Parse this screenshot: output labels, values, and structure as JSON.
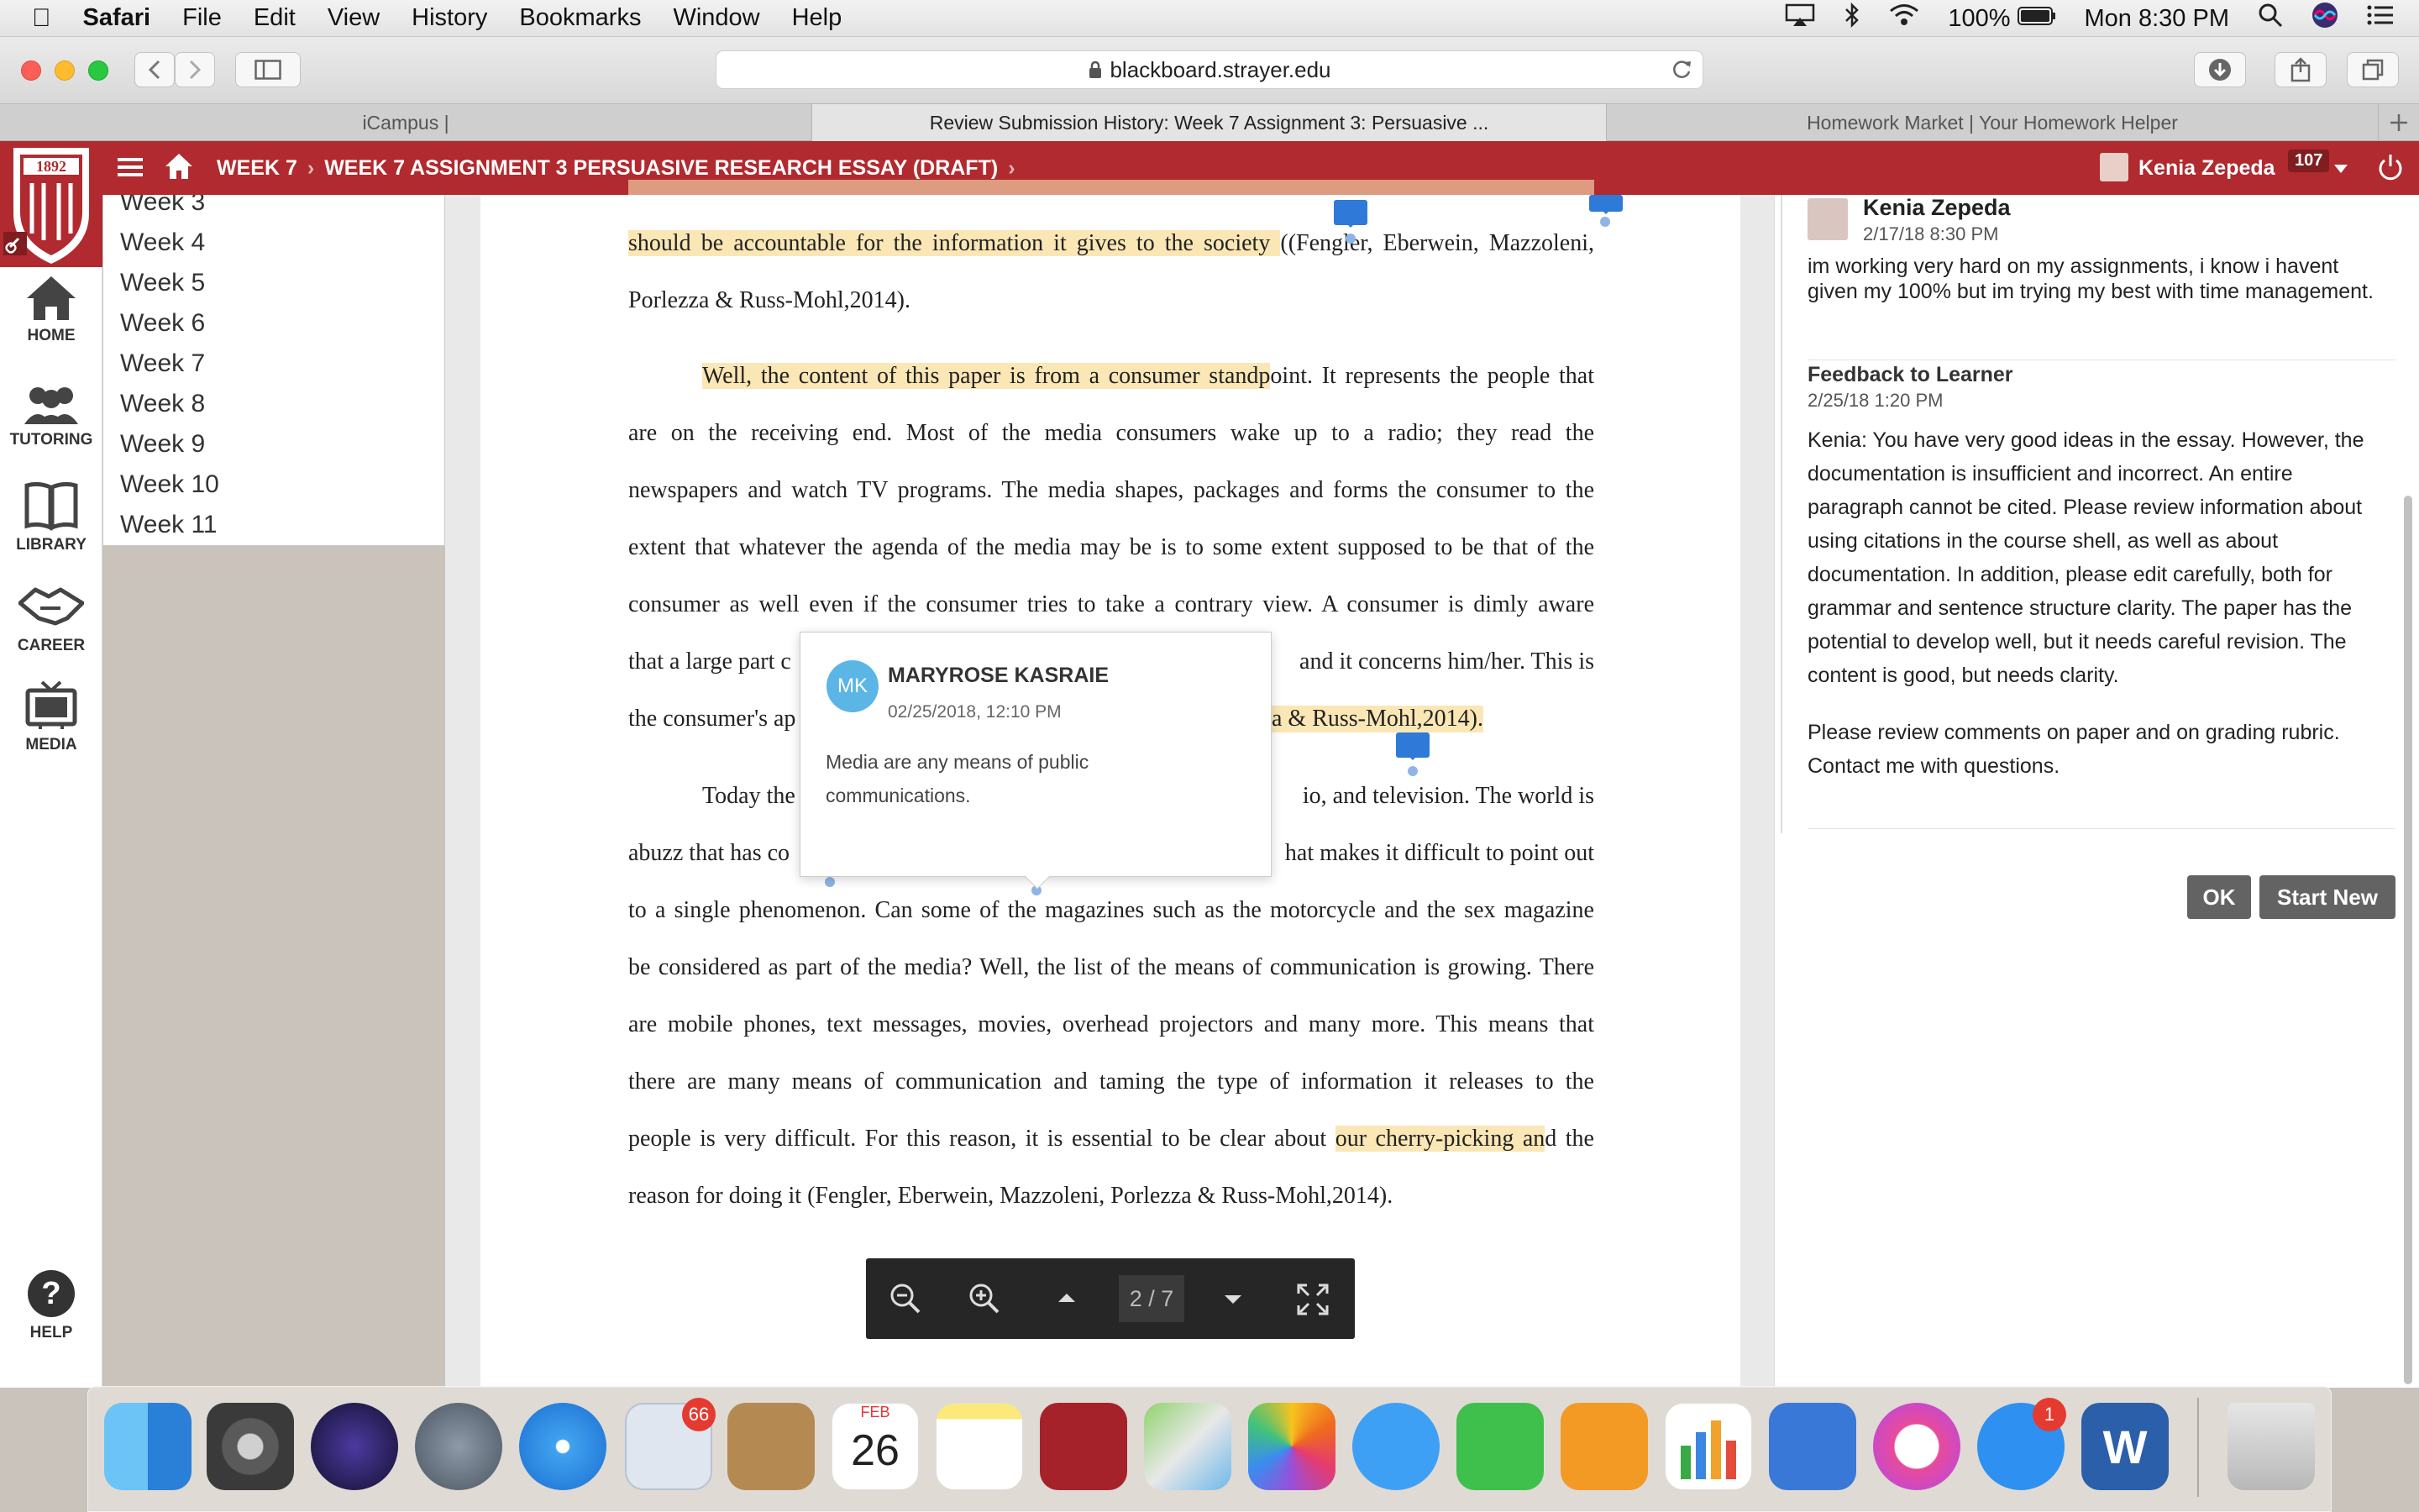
{
  "menubar": {
    "app": "Safari",
    "items": [
      "File",
      "Edit",
      "View",
      "History",
      "Bookmarks",
      "Window",
      "Help"
    ],
    "battery": "100%",
    "clock": "Mon 8:30 PM"
  },
  "browser": {
    "url": "blackboard.strayer.edu",
    "tabs": [
      {
        "title": "iCampus |",
        "active": false
      },
      {
        "title": "Review Submission History: Week 7 Assignment 3: Persuasive ...",
        "active": true
      },
      {
        "title": "Homework Market | Your Homework Helper",
        "active": false
      }
    ]
  },
  "header": {
    "logo_year": "1892",
    "breadcrumb": [
      "WEEK 7",
      "WEEK 7 ASSIGNMENT 3 PERSUASIVE RESEARCH ESSAY (DRAFT)"
    ],
    "user_name": "Kenia Zepeda",
    "notification_count": "107",
    "brand_color": "#b02a2f"
  },
  "leftnav": {
    "items": [
      "HOME",
      "TUTORING",
      "LIBRARY",
      "CAREER",
      "MEDIA"
    ],
    "help": "HELP"
  },
  "weeks": [
    "Week 3",
    "Week 4",
    "Week 5",
    "Week 6",
    "Week 7",
    "Week 8",
    "Week 9",
    "Week 10",
    "Week 11"
  ],
  "document": {
    "lines": [
      {
        "text": "should be accountable for the information it gives to the society ",
        "tail": "((Fengler, Eberwein, Mazzoleni,"
      },
      {
        "text": "Porlezza & Russ-Mohl,2014)."
      },
      {
        "highlight": "Well, the content of this paper is from a consumer standp",
        "text": "oint. It represents the people that"
      },
      {
        "text": "are on the receiving end. Most of the media consumers wake up to a radio; they read the"
      },
      {
        "text": "newspapers and watch TV programs. The media shapes, packages and forms the consumer to the"
      },
      {
        "text": "extent that whatever the agenda of the media may be is to some extent supposed to be that of the"
      },
      {
        "text": "consumer as well even if the consumer tries to take a contrary view. A consumer is dimly aware"
      },
      {
        "left": "that a large part c",
        "right": "and it concerns him/her. This is"
      },
      {
        "left": "the consumer's ap",
        "right": "a & Russ-Mohl,2014)."
      },
      {
        "left": "Today the",
        "right": "io, and television. The world is"
      },
      {
        "left": "abuzz that has co",
        "right": "hat makes it difficult to point out"
      },
      {
        "text": "to a single phenomenon.  Can some of the magazines such as the motorcycle and the sex magazine"
      },
      {
        "text": "be considered as part of the media? Well, the list of the means of communication is growing. There"
      },
      {
        "text": "are mobile phones, text messages, movies, overhead projectors and many more. This means that"
      },
      {
        "text": "there are many means of communication and taming the type of information it releases to the"
      },
      {
        "text": "people is very difficult. For this reason, it is essential to be clear about ",
        "highlight": "our cherry-picking an",
        "tail": "d the"
      },
      {
        "text": "reason for doing it (Fengler, Eberwein, Mazzoleni, Porlezza & Russ-Mohl,2014)."
      }
    ],
    "highlight_color": "#fbe7b5"
  },
  "comment_popup": {
    "initials": "MK",
    "author": "MARYROSE KASRAIE",
    "date": "02/25/2018, 12:10 PM",
    "body_line1": "Media are any means of public",
    "body_line2": "communications."
  },
  "doc_toolbar": {
    "page_indicator": "2 / 7"
  },
  "right_panel": {
    "student_name": "Kenia Zepeda",
    "student_date": "2/17/18 8:30 PM",
    "student_comment": "im working very hard on my assignments, i know i havent given my 100% but im trying my best with time management.",
    "feedback_title": "Feedback to Learner",
    "feedback_date": "2/25/18 1:20 PM",
    "feedback_body": "Kenia: You have very good ideas in the essay. However, the documentation is insufficient and incorrect. An entire paragraph cannot be cited. Please review information about using citations in the course shell, as well as about documentation. In addition, please edit carefully, both for grammar and sentence structure clarity. The paper has the potential to develop well, but it needs careful revision. The content is good, but needs clarity.",
    "feedback_body2": "Please review comments on paper and on grading rubric. Contact me with questions.",
    "ok_label": "OK",
    "start_new_label": "Start New"
  },
  "dock": {
    "mail_badge": "66",
    "calendar_month": "FEB",
    "calendar_day": "26",
    "appstore_badge": "1",
    "word_letter": "W"
  }
}
